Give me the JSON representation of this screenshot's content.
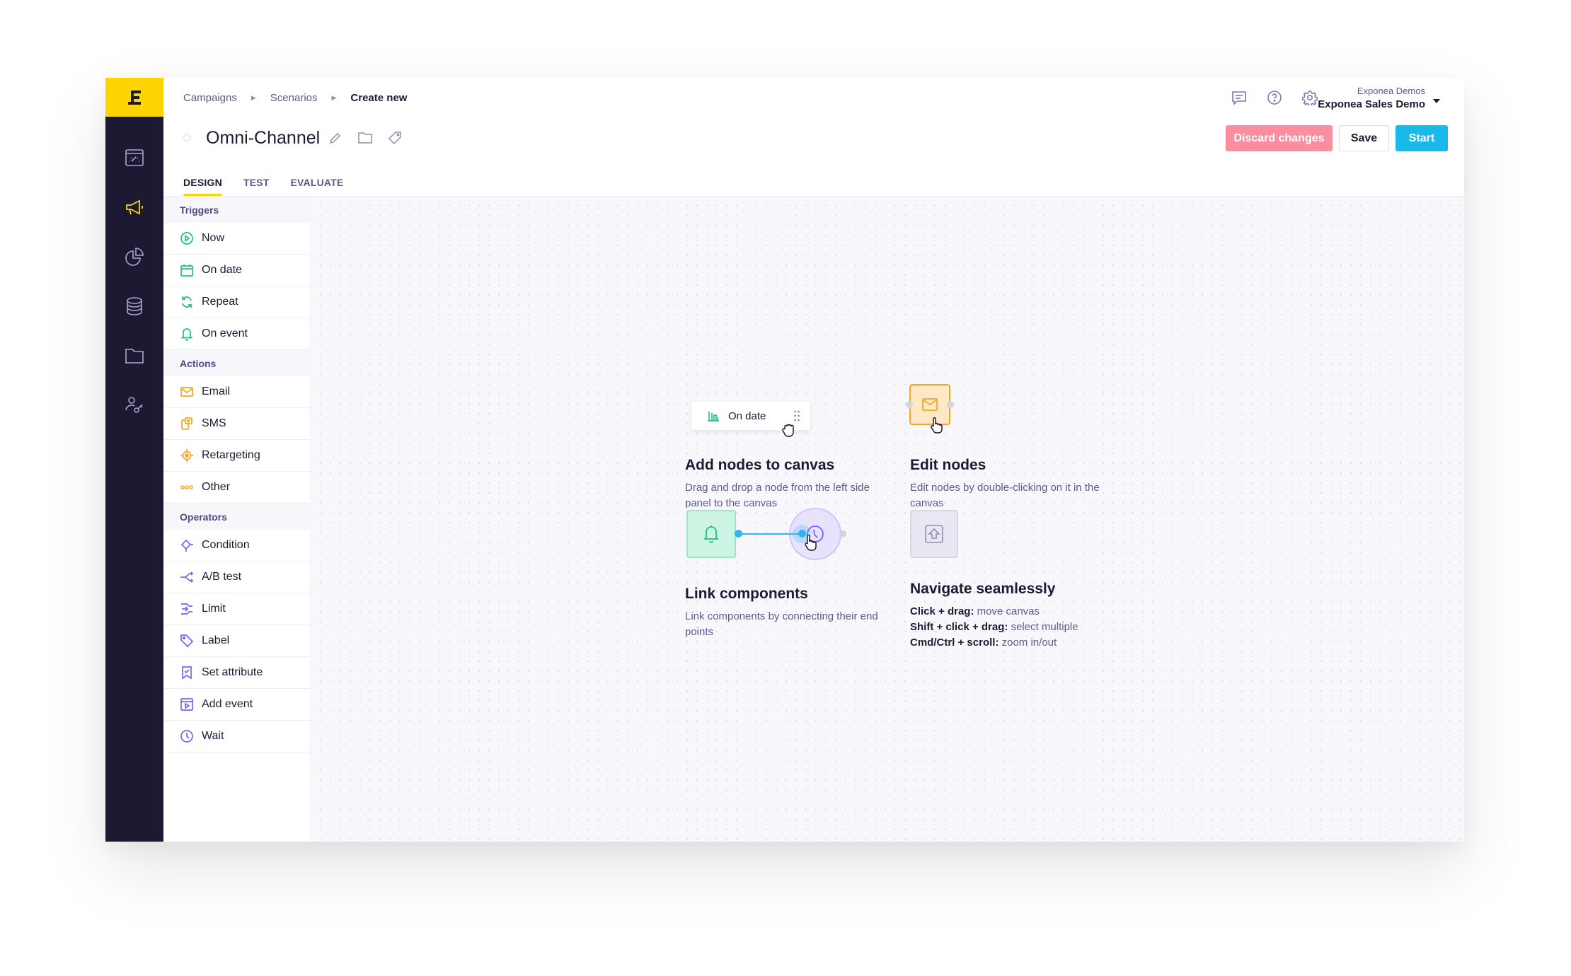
{
  "breadcrumb": {
    "items": [
      "Campaigns",
      "Scenarios"
    ],
    "current": "Create new"
  },
  "scenario": {
    "title": "Omni-Channel"
  },
  "tabs": [
    {
      "label": "DESIGN",
      "active": true
    },
    {
      "label": "TEST",
      "active": false
    },
    {
      "label": "EVALUATE",
      "active": false
    }
  ],
  "account": {
    "org": "Exponea Demos",
    "project": "Exponea Sales Demo"
  },
  "actions": {
    "discard": "Discard changes",
    "save": "Save",
    "start": "Start"
  },
  "rail": {
    "logo": "E",
    "items": [
      {
        "icon": "dashboard-icon",
        "active": false
      },
      {
        "icon": "megaphone-icon",
        "active": true
      },
      {
        "icon": "pie-chart-icon",
        "active": false
      },
      {
        "icon": "database-icon",
        "active": false
      },
      {
        "icon": "folder-icon",
        "active": false
      },
      {
        "icon": "user-key-icon",
        "active": false
      }
    ]
  },
  "panel": {
    "sections": [
      {
        "title": "Triggers",
        "items": [
          {
            "label": "Now",
            "icon": "play-circle-icon"
          },
          {
            "label": "On date",
            "icon": "calendar-icon"
          },
          {
            "label": "Repeat",
            "icon": "repeat-icon"
          },
          {
            "label": "On event",
            "icon": "bell-icon"
          }
        ]
      },
      {
        "title": "Actions",
        "items": [
          {
            "label": "Email",
            "icon": "email-icon"
          },
          {
            "label": "SMS",
            "icon": "sms-icon"
          },
          {
            "label": "Retargeting",
            "icon": "target-icon"
          },
          {
            "label": "Other",
            "icon": "dots-icon"
          }
        ]
      },
      {
        "title": "Operators",
        "items": [
          {
            "label": "Condition",
            "icon": "condition-icon"
          },
          {
            "label": "A/B test",
            "icon": "split-icon"
          },
          {
            "label": "Limit",
            "icon": "limit-icon"
          },
          {
            "label": "Label",
            "icon": "tag-icon"
          },
          {
            "label": "Set attribute",
            "icon": "bookmark-check-icon"
          },
          {
            "label": "Add event",
            "icon": "add-event-icon"
          },
          {
            "label": "Wait",
            "icon": "clock-icon"
          }
        ]
      }
    ]
  },
  "colors": {
    "brand_yellow": "#fed502",
    "rail_dark": "#1c1933",
    "trigger_green": "#1fc27e",
    "action_orange": "#f5a623",
    "operator_purple": "#7b61ff",
    "start_blue": "#19b9ea",
    "discard_pink": "#fa8ea0"
  },
  "tips": {
    "add": {
      "node_label": "On date",
      "title": "Add nodes to canvas",
      "text": "Drag and drop a node from the left side panel to the canvas"
    },
    "edit": {
      "title": "Edit nodes",
      "text": "Edit nodes by double-clicking on it in the canvas"
    },
    "link": {
      "title": "Link components",
      "text": "Link components by connecting their end points"
    },
    "navigate": {
      "title": "Navigate seamlessly",
      "lines": [
        {
          "key": "Click + drag:",
          "value": "move canvas"
        },
        {
          "key": "Shift + click + drag:",
          "value": "select multiple"
        },
        {
          "key": "Cmd/Ctrl + scroll:",
          "value": "zoom in/out"
        }
      ]
    }
  }
}
